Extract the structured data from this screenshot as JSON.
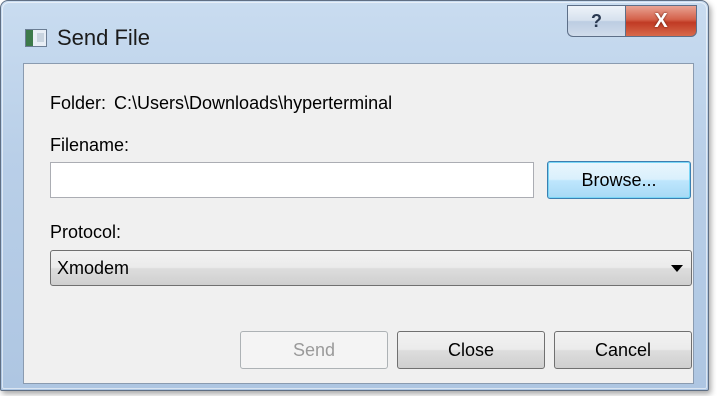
{
  "window": {
    "title": "Send File",
    "help_glyph": "?",
    "close_glyph": "X"
  },
  "folder": {
    "label": "Folder:",
    "path": "C:\\Users\\Downloads\\hyperterminal"
  },
  "filename": {
    "label": "Filename:",
    "value": "",
    "placeholder": ""
  },
  "browse_label": "Browse...",
  "protocol": {
    "label": "Protocol:",
    "selected": "Xmodem"
  },
  "buttons": {
    "send": "Send",
    "close": "Close",
    "cancel": "Cancel"
  },
  "colors": {
    "title_bar": "#b9cfe8",
    "client_bg": "#f0f0f0",
    "close_red": "#c03a24",
    "focus_blue": "#3c7fb1"
  },
  "icons": {
    "app": "terminal-app-icon",
    "help": "help-icon",
    "close": "close-icon",
    "dropdown": "chevron-down-icon"
  }
}
